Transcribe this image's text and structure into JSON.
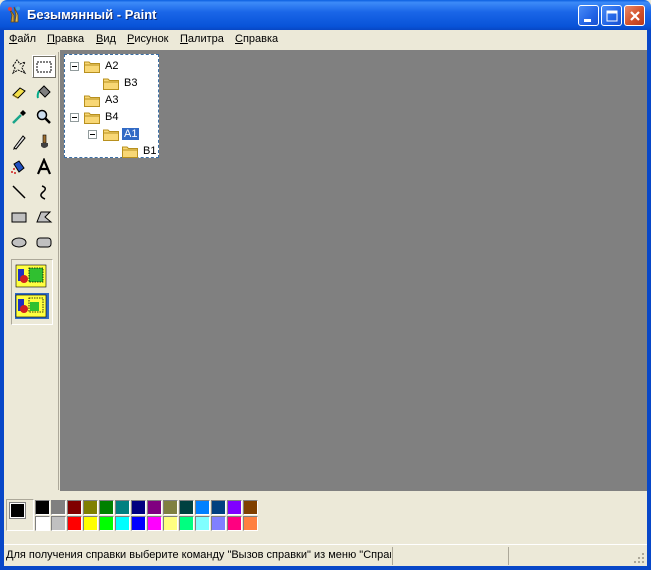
{
  "window": {
    "title": "Безымянный - Paint"
  },
  "menu": [
    {
      "label": "Файл",
      "accel": "Ф",
      "rest": "айл"
    },
    {
      "label": "Правка",
      "accel": "П",
      "rest": "равка"
    },
    {
      "label": "Вид",
      "accel": "В",
      "rest": "ид"
    },
    {
      "label": "Рисунок",
      "accel": "Р",
      "rest": "исунок"
    },
    {
      "label": "Палитра",
      "accel": "П",
      "rest": "алитра"
    },
    {
      "label": "Справка",
      "accel": "С",
      "rest": "правка"
    }
  ],
  "tools": [
    "free-form-select",
    "rectangle-select",
    "eraser",
    "fill-with-color",
    "pick-color",
    "magnifier",
    "pencil",
    "brush",
    "airbrush",
    "text",
    "line",
    "curve",
    "rectangle",
    "polygon",
    "ellipse",
    "rounded-rectangle"
  ],
  "selected_tool": "rectangle-select",
  "tree": [
    {
      "label": "A2",
      "expander": true
    },
    {
      "label": "B3",
      "expander": false
    },
    {
      "label": "A3",
      "expander": false
    },
    {
      "label": "B4",
      "expander": true
    },
    {
      "label": "A1",
      "expander": true,
      "selected": true
    },
    {
      "label": "B1",
      "expander": false
    }
  ],
  "palette": {
    "foreground": "#000000",
    "background": "#ffffff",
    "top": [
      "#000000",
      "#808080",
      "#800000",
      "#808000",
      "#008000",
      "#008080",
      "#000080",
      "#800080",
      "#808040",
      "#004040",
      "#0080ff",
      "#004080",
      "#8000ff",
      "#804000"
    ],
    "bottom": [
      "#ffffff",
      "#c0c0c0",
      "#ff0000",
      "#ffff00",
      "#00ff00",
      "#00ffff",
      "#0000ff",
      "#ff00ff",
      "#ffff80",
      "#00ff80",
      "#80ffff",
      "#8080ff",
      "#ff0080",
      "#ff8040"
    ]
  },
  "status": {
    "text": "Для получения справки выберите команду \"Вызов справки\" из меню \"Справка\"."
  }
}
